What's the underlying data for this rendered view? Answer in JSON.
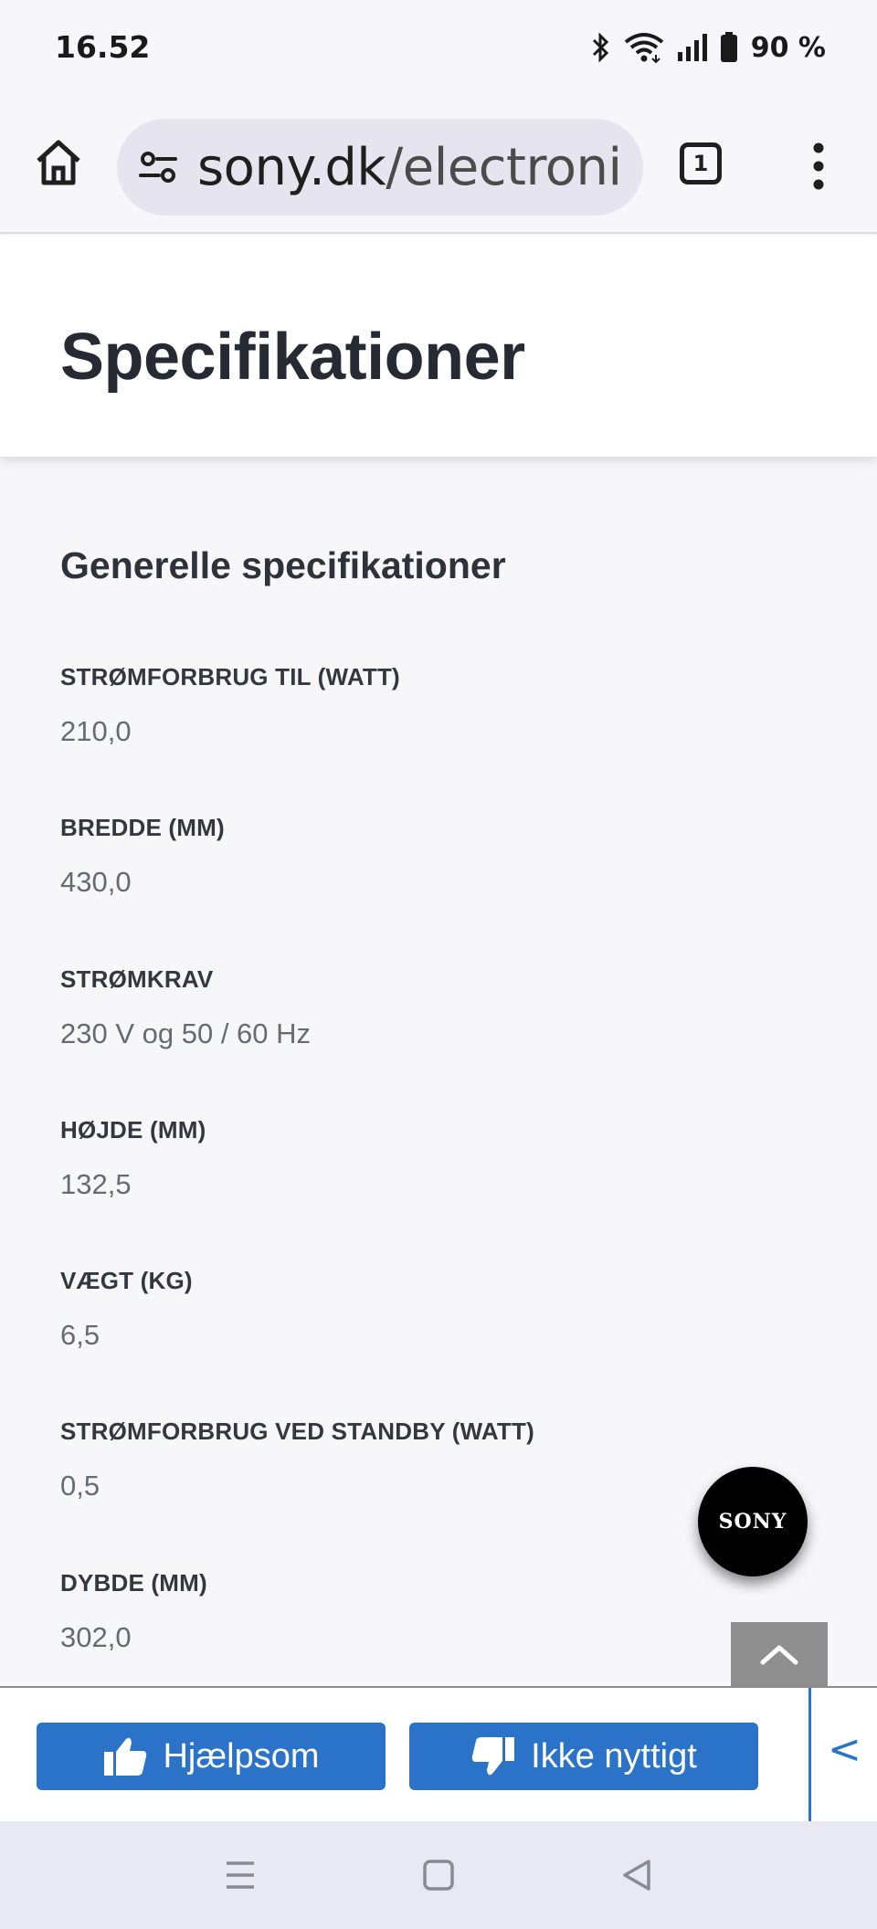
{
  "status_bar": {
    "time": "16.52",
    "battery": "90 %"
  },
  "browser": {
    "url_domain": "sony.dk",
    "url_path": "/electroni",
    "tab_count": "1"
  },
  "page": {
    "title": "Specifikationer",
    "section_title": "Generelle specifikationer",
    "specs": [
      {
        "label": "STRØMFORBRUG TIL (WATT)",
        "value": "210,0"
      },
      {
        "label": "BREDDE (MM)",
        "value": "430,0"
      },
      {
        "label": "STRØMKRAV",
        "value": "230 V og 50 / 60 Hz"
      },
      {
        "label": "HØJDE (MM)",
        "value": "132,5"
      },
      {
        "label": "VÆGT (KG)",
        "value": "6,5"
      },
      {
        "label": "STRØMFORBRUG VED STANDBY (WATT)",
        "value": "0,5"
      },
      {
        "label": "DYBDE (MM)",
        "value": "302,0"
      }
    ]
  },
  "fab": {
    "logo": "SONY"
  },
  "feedback": {
    "helpful_label": "Hjælpsom",
    "not_helpful_label": "Ikke nyttigt",
    "collapse_label": "<"
  },
  "colors": {
    "accent": "#2a73c9",
    "title_text": "#262b33",
    "value_text": "#666b73"
  }
}
